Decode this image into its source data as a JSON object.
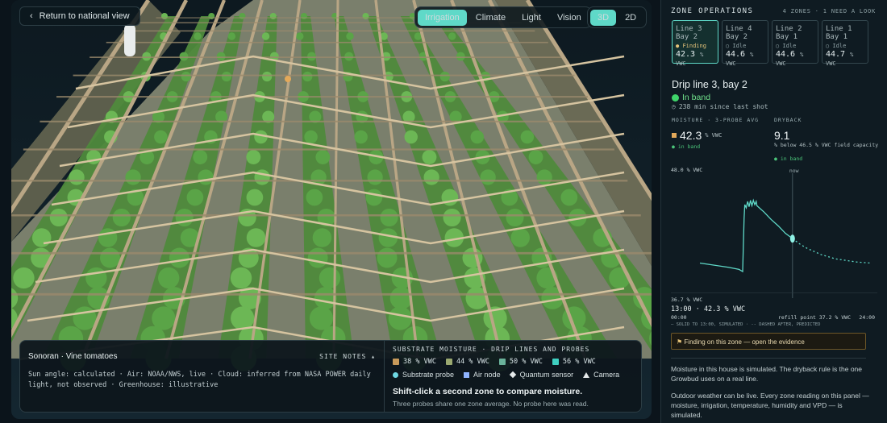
{
  "nav": {
    "back_label": "Return to national view"
  },
  "layers": {
    "tabs": [
      "Irrigation",
      "Climate",
      "Light",
      "Vision"
    ],
    "active": "Irrigation"
  },
  "view": {
    "modes": [
      "3D",
      "2D"
    ],
    "active": "3D"
  },
  "site": {
    "name": "Sonoran · Vine tomatoes",
    "notes_label": "SITE NOTES",
    "notes_caret": "▴",
    "notes_line1": "Sun angle: calculated · Air: NOAA/NWS, live · Cloud: inferred from NASA POWER daily",
    "notes_line2": "light, not observed · Greenhouse: illustrative"
  },
  "legend": {
    "title": "SUBSTRATE MOISTURE · DRIP LINES AND PROBES",
    "swatches": [
      {
        "label": "38 % VWC",
        "color": "#c8995a"
      },
      {
        "label": "44 % VWC",
        "color": "#9aa870"
      },
      {
        "label": "50 % VWC",
        "color": "#6ab39a"
      },
      {
        "label": "56 % VWC",
        "color": "#3fcfc0"
      }
    ],
    "markers": [
      {
        "icon": "circle",
        "label": "Substrate probe",
        "color": "#6fd8e3"
      },
      {
        "icon": "square",
        "label": "Air node",
        "color": "#8fb4ff"
      },
      {
        "icon": "diamond",
        "label": "Quantum sensor",
        "color": "#e5e9ea"
      },
      {
        "icon": "triangle",
        "label": "Camera",
        "color": "#e5e9ea"
      }
    ],
    "hint_title": "Shift-click a second zone to compare moisture.",
    "hint_sub": "Three probes share one zone average. No probe here was read."
  },
  "panel": {
    "title": "ZONE OPERATIONS",
    "summary": "4 ZONES · 1 NEED A LOOK",
    "zones": [
      {
        "line": "Line 3",
        "bay": "Bay 2",
        "status": "Finding",
        "value": "42.3",
        "unit": "% VWC",
        "selected": true
      },
      {
        "line": "Line 4",
        "bay": "Bay 2",
        "status": "Idle",
        "value": "44.6",
        "unit": "% VWC",
        "selected": false
      },
      {
        "line": "Line 2",
        "bay": "Bay 1",
        "status": "Idle",
        "value": "44.6",
        "unit": "% VWC",
        "selected": false
      },
      {
        "line": "Line 1",
        "bay": "Bay 1",
        "status": "Idle",
        "value": "44.7",
        "unit": "% VWC",
        "selected": false
      }
    ],
    "detail": {
      "title": "Drip line 3, bay 2",
      "band": "In band",
      "since": "238 min since last shot",
      "moisture_label": "MOISTURE · 3-PROBE AVG",
      "moisture_value": "42.3",
      "moisture_unit": "% VWC",
      "moisture_state": "● in band",
      "dryback_label": "DRYBACK",
      "dryback_value": "9.1",
      "dryback_note": "% below 46.5 % VWC field capacity",
      "dryback_state": "● in band"
    },
    "chart": {
      "y_top": "48.0 % VWC",
      "y_bottom": "36.7 % VWC",
      "now_label": "now",
      "current": "13:00 · 42.3 % VWC",
      "x_start": "00:00",
      "x_end": "24:00",
      "refill_label": "refill point 37.2 % VWC",
      "footnote": "— SOLID TO 13:00, SIMULATED · -- DASHED AFTER, PREDICTED"
    },
    "evidence_label": "Finding on this zone — open the evidence",
    "note1": "Moisture in this house is simulated. The dryback rule is the one Growbud uses on a real line.",
    "note2": "Outdoor weather can be live. Every zone reading on this panel — moisture, irrigation, temperature, humidity and VPD — is simulated."
  },
  "chart_data": {
    "type": "line",
    "title": "",
    "xlabel": "",
    "ylabel": "",
    "xlim": [
      0,
      24
    ],
    "ylim": [
      36.7,
      48.0
    ],
    "series": [
      {
        "style": "solid",
        "x": [
          0,
          2,
          4,
          5.5,
          6.0,
          6.2,
          6.3,
          6.5,
          6.7,
          6.9,
          7.1,
          7.3,
          7.5,
          7.7,
          7.9,
          8.0,
          9,
          10,
          11,
          12,
          13
        ],
        "y": [
          40.0,
          39.8,
          39.6,
          39.4,
          39.2,
          44.2,
          45.5,
          45.2,
          45.8,
          45.3,
          45.9,
          45.4,
          45.9,
          45.5,
          45.8,
          45.4,
          44.8,
          44.1,
          43.5,
          42.8,
          42.3
        ]
      },
      {
        "style": "dashed",
        "x": [
          13,
          14,
          15,
          16,
          17,
          18,
          19,
          20,
          21,
          22,
          23,
          24
        ],
        "y": [
          42.3,
          41.8,
          41.4,
          41.1,
          40.8,
          40.6,
          40.4,
          40.3,
          40.2,
          40.1,
          40.05,
          40.0
        ]
      }
    ],
    "now_x": 13,
    "current_value": 42.3,
    "refill_point": 37.2
  }
}
